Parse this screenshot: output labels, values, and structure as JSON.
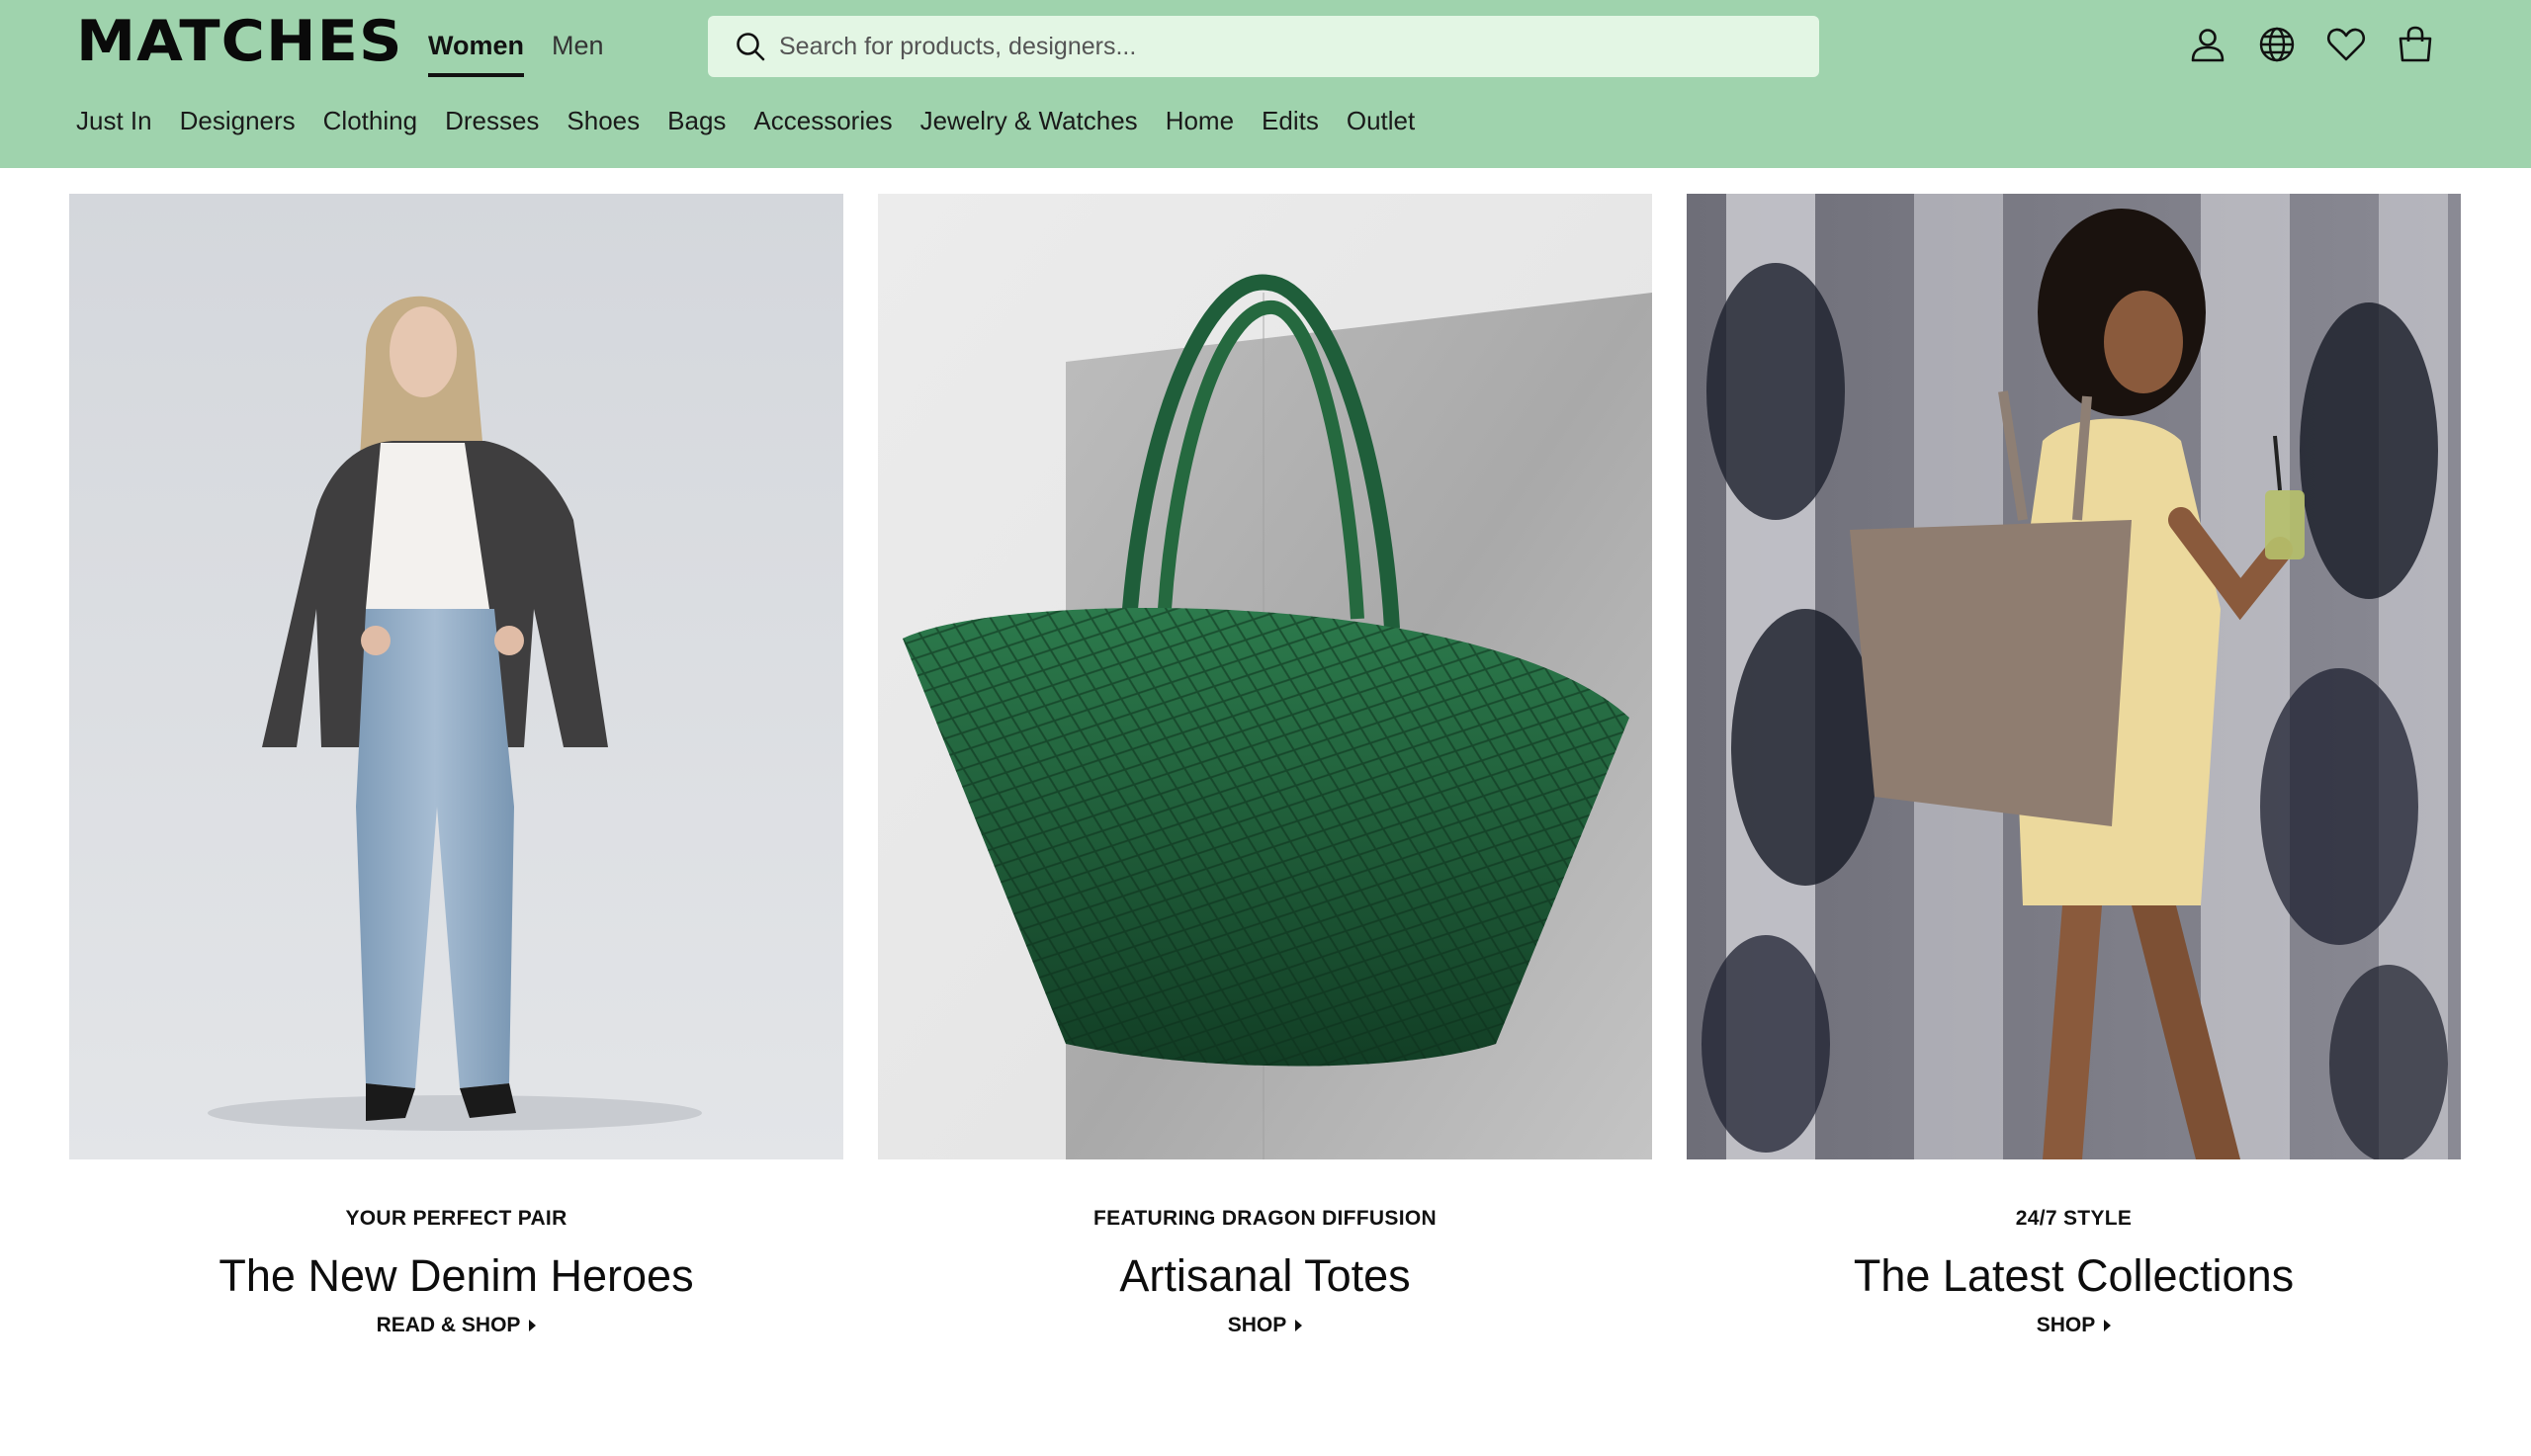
{
  "brand": {
    "logo_text": "MATCHES"
  },
  "gender_tabs": [
    {
      "label": "Women",
      "active": true
    },
    {
      "label": "Men",
      "active": false
    }
  ],
  "search": {
    "placeholder": "Search for products, designers..."
  },
  "header_icons": [
    "account-icon",
    "globe-icon",
    "wishlist-heart-icon",
    "bag-icon"
  ],
  "nav": {
    "items": [
      {
        "label": "Just In"
      },
      {
        "label": "Designers"
      },
      {
        "label": "Clothing"
      },
      {
        "label": "Dresses"
      },
      {
        "label": "Shoes"
      },
      {
        "label": "Bags"
      },
      {
        "label": "Accessories"
      },
      {
        "label": "Jewelry & Watches"
      },
      {
        "label": "Home"
      },
      {
        "label": "Edits"
      },
      {
        "label": "Outlet"
      }
    ]
  },
  "tiles": [
    {
      "eyebrow": "YOUR PERFECT PAIR",
      "title": "The New Denim Heroes",
      "cta": "READ & SHOP"
    },
    {
      "eyebrow": "FEATURING DRAGON DIFFUSION",
      "title": "Artisanal Totes",
      "cta": "SHOP"
    },
    {
      "eyebrow": "24/7 STYLE",
      "title": "The Latest Collections",
      "cta": "SHOP"
    }
  ],
  "colors": {
    "header_bg": "#9fd3ad",
    "search_bg": "#e3f6e4",
    "text": "#111111",
    "tote_green": "#1f5e3a"
  }
}
